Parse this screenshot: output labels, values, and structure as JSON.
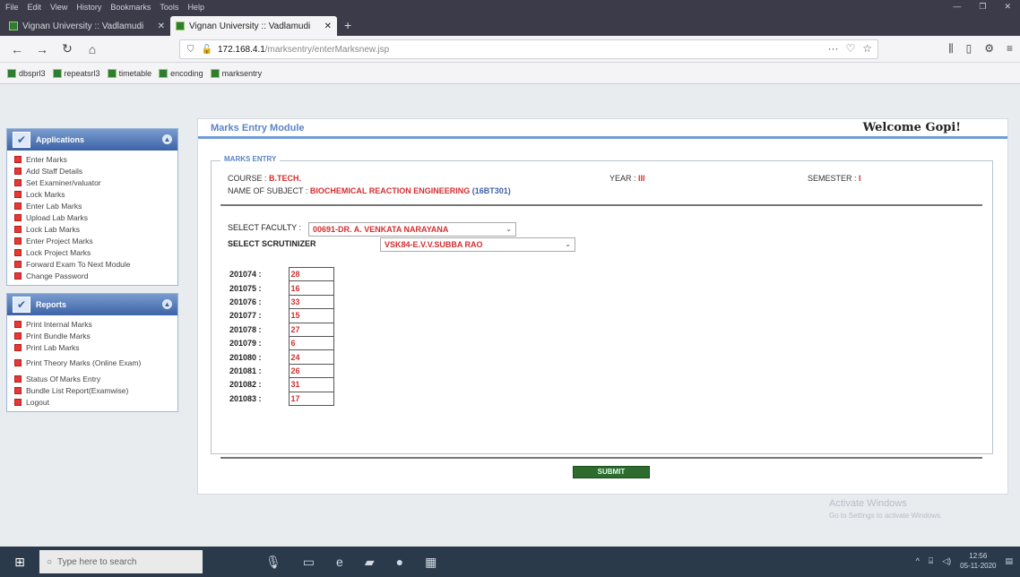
{
  "browser": {
    "menu": [
      "File",
      "Edit",
      "View",
      "History",
      "Bookmarks",
      "Tools",
      "Help"
    ],
    "tabs": [
      {
        "label": "Vignan University :: Vadlamudi",
        "active": false
      },
      {
        "label": "Vignan University :: Vadlamudi",
        "active": true
      }
    ],
    "url_host": "172.168.4.1",
    "url_path": "/marksentry/enterMarksnew.jsp",
    "bookmarks": [
      "dbsprl3",
      "repeatsrl3",
      "timetable",
      "encoding",
      "marksentry"
    ]
  },
  "sidebar": {
    "applications": {
      "title": "Applications",
      "items": [
        "Enter Marks",
        "Add Staff Details",
        "Set Examiner/valuator",
        "Lock Marks",
        "Enter Lab Marks",
        "Upload Lab Marks",
        "Lock Lab Marks",
        "Enter Project Marks",
        "Lock Project Marks",
        "Forward Exam To Next Module",
        "Change Password"
      ]
    },
    "reports": {
      "title": "Reports",
      "items": [
        "Print Internal Marks",
        "Print Bundle Marks",
        "Print Lab Marks",
        "Print Theory Marks (Online Exam)",
        "Status Of Marks Entry",
        "Bundle List Report(Examwise)",
        "Logout"
      ]
    }
  },
  "main": {
    "module_title": "Marks Entry Module",
    "welcome": "Welcome Gopi!",
    "legend": "MARKS ENTRY",
    "course_label": "COURSE :",
    "course_value": "B.TECH.",
    "year_label": "YEAR :",
    "year_value": "III",
    "semester_label": "SEMESTER :",
    "semester_value": "I",
    "subject_label": "NAME OF SUBJECT :",
    "subject_value": "BIOCHEMICAL REACTION ENGINEERING",
    "subject_code": "(16BT301)",
    "faculty_label": "SELECT FACULTY :",
    "faculty_value": "00691-DR. A. VENKATA NARAYANA",
    "scrutinizer_label": "SELECT SCRUTINIZER",
    "scrutinizer_value": "VSK84-E.V.V.SUBBA RAO",
    "marks": [
      {
        "roll": "201074 :",
        "mark": "28"
      },
      {
        "roll": "201075 :",
        "mark": "16"
      },
      {
        "roll": "201076 :",
        "mark": "33"
      },
      {
        "roll": "201077 :",
        "mark": "15"
      },
      {
        "roll": "201078 :",
        "mark": "27"
      },
      {
        "roll": "201079 :",
        "mark": "6"
      },
      {
        "roll": "201080 :",
        "mark": "24"
      },
      {
        "roll": "201081 :",
        "mark": "26"
      },
      {
        "roll": "201082 :",
        "mark": "31"
      },
      {
        "roll": "201083 :",
        "mark": "17"
      }
    ],
    "submit_label": "SUBMIT"
  },
  "watermark": {
    "line1": "Activate Windows",
    "line2": "Go to Settings to activate Windows."
  },
  "taskbar": {
    "search_placeholder": "Type here to search",
    "time": "12:56",
    "date": "05-11-2020"
  }
}
